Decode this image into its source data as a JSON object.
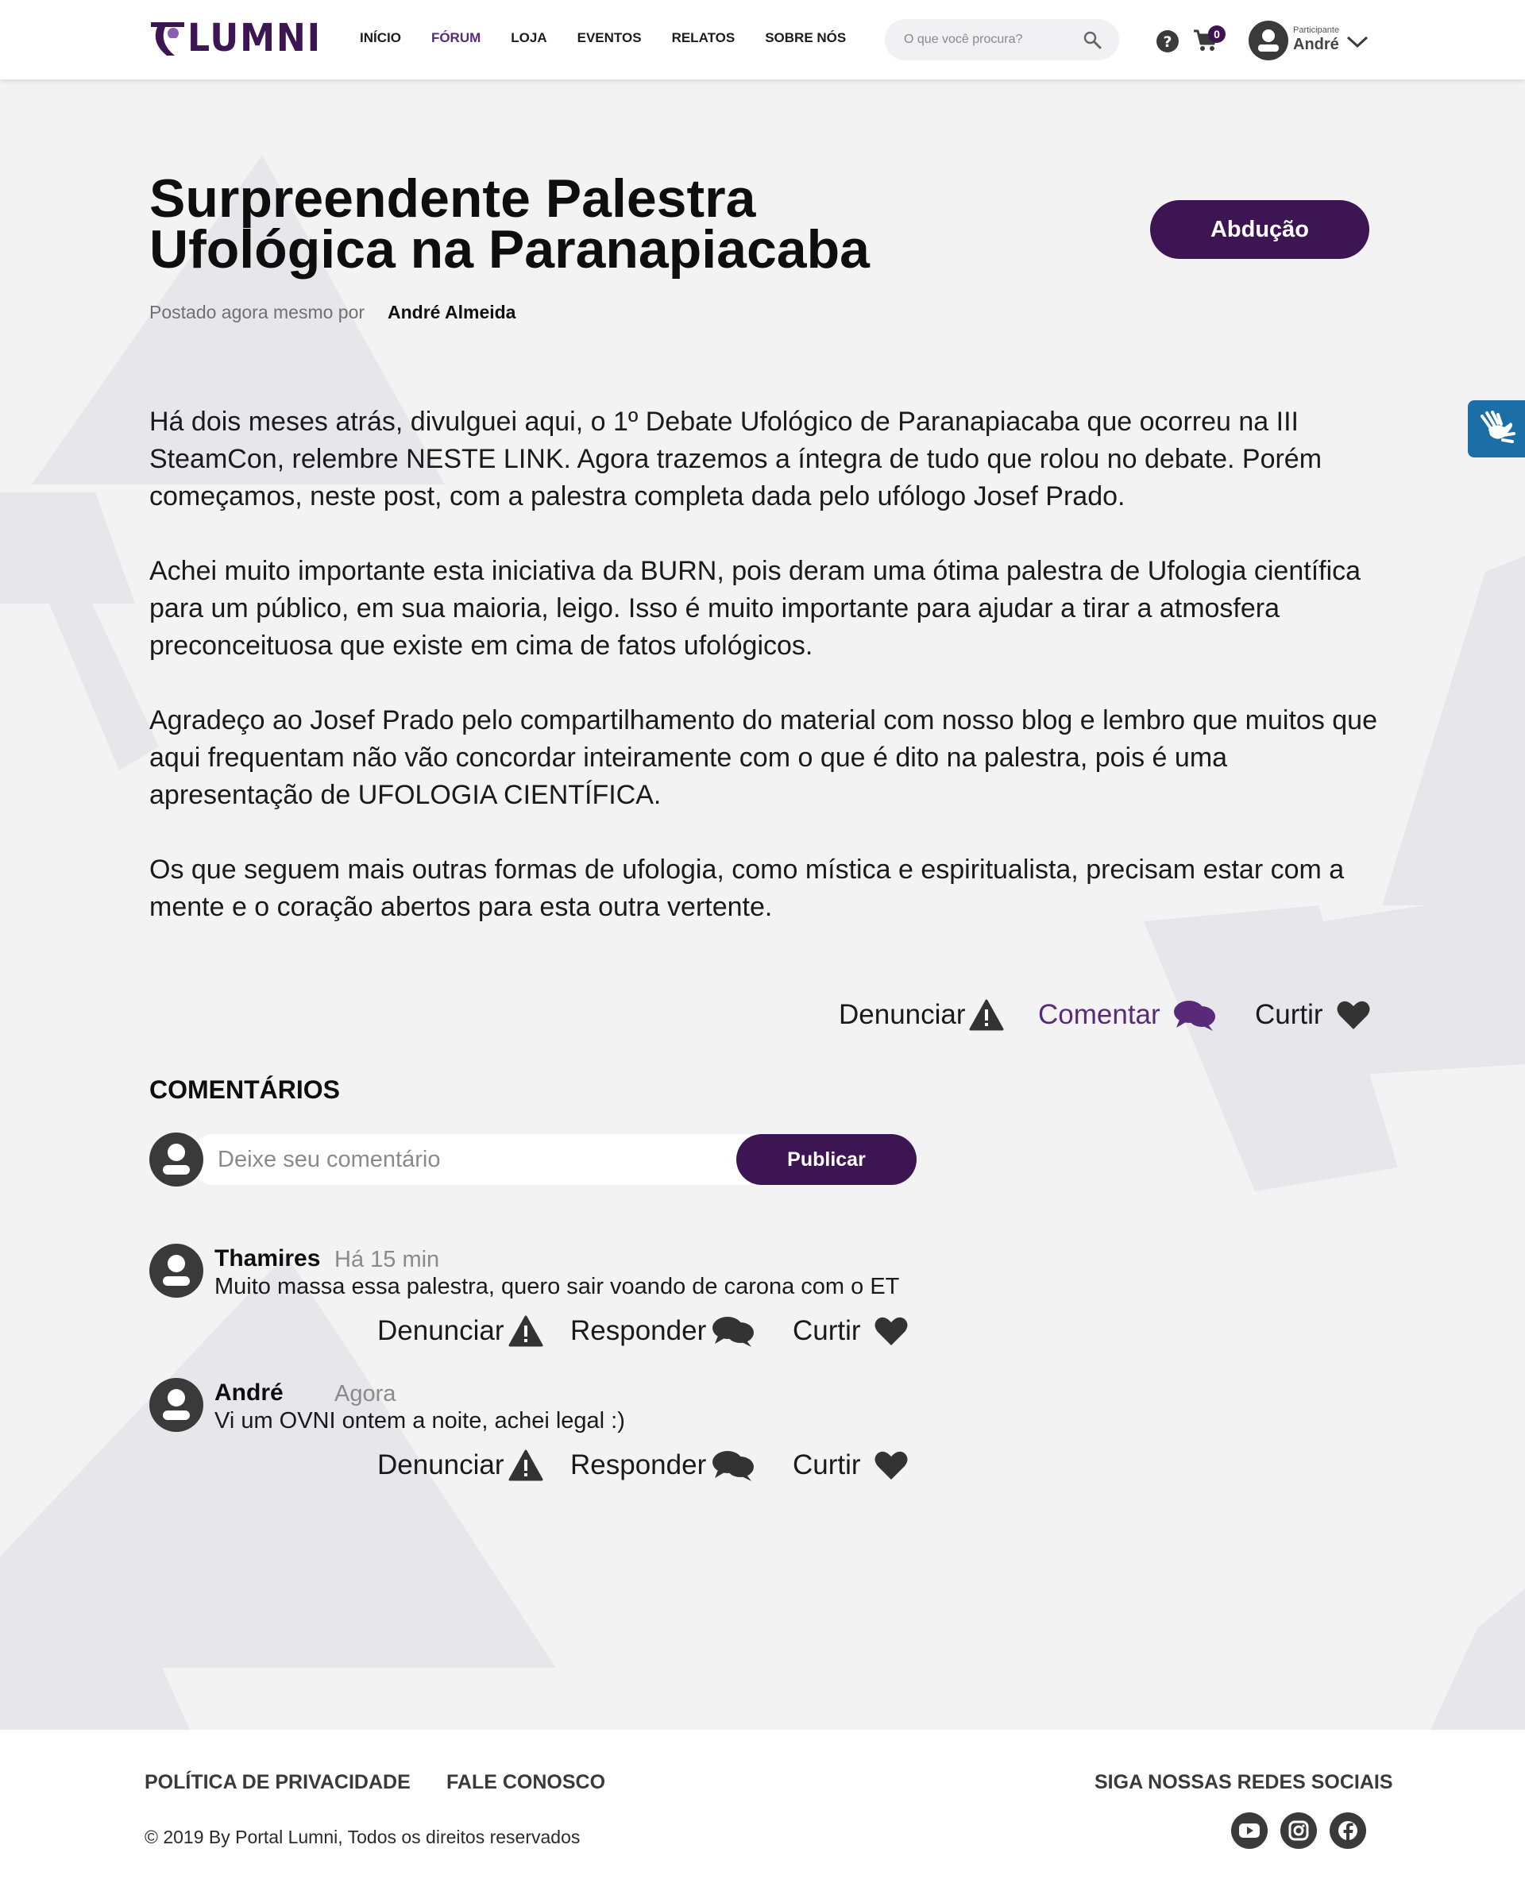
{
  "nav": {
    "logo_text": "LUMNI",
    "items": [
      {
        "label": "INÍCIO",
        "active": false
      },
      {
        "label": "FÓRUM",
        "active": true
      },
      {
        "label": "LOJA",
        "active": false
      },
      {
        "label": "EVENTOS",
        "active": false
      },
      {
        "label": "RELATOS",
        "active": false
      },
      {
        "label": "SOBRE NÓS",
        "active": false
      }
    ],
    "search_placeholder": "O que você procura?",
    "cart_count": "0",
    "user_role": "Participante",
    "user_name": "André"
  },
  "post": {
    "title": "Surpreendente Palestra Ufológica na Paranapiacaba",
    "tag": "Abdução",
    "meta": "Postado agora mesmo por",
    "author": "André Almeida",
    "paragraphs": [
      "Há dois meses atrás, divulguei aqui, o 1º Debate Ufológico de Paranapiacaba que ocorreu na III SteamCon, relembre NESTE LINK. Agora trazemos a íntegra de tudo que rolou no debate. Porém começamos, neste post, com a palestra completa dada pelo ufólogo Josef Prado.",
      "Achei muito importante esta iniciativa da BURN, pois deram uma ótima palestra de Ufologia científica para um público, em sua maioria, leigo. Isso é muito importante para ajudar a tirar a atmosfera preconceituosa que existe em cima de fatos ufológicos.",
      "Agradeço ao Josef Prado pelo compartilhamento do material com nosso blog e lembro que muitos que aqui frequentam não vão concordar inteiramente com o que é dito na palestra, pois é uma apresentação de UFOLOGIA CIENTÍFICA.",
      "Os que seguem mais outras formas de ufologia, como mística e espiritualista, precisam estar com a mente e o coração abertos para esta outra vertente."
    ],
    "actions": {
      "report": "Denunciar",
      "comment": "Comentar",
      "like": "Curtir"
    }
  },
  "comments": {
    "title": "COMENTÁRIOS",
    "input_placeholder": "Deixe seu comentário",
    "publish_label": "Publicar",
    "items": [
      {
        "author": "Thamires",
        "time": "Há 15 min",
        "text": "Muito massa essa palestra, quero sair voando de carona com o ET"
      },
      {
        "author": "André",
        "time": "Agora",
        "text": "Vi um OVNI ontem a noite, achei legal :)"
      }
    ],
    "actions": {
      "report": "Denunciar",
      "reply": "Responder",
      "like": "Curtir"
    }
  },
  "footer": {
    "privacy": "POLÍTICA DE PRIVACIDADE",
    "contact": "FALE CONOSCO",
    "copyright": "© 2019 By Portal Lumni, Todos os direitos reservados",
    "social_title": "SIGA NOSSAS REDES SOCIAIS",
    "social_icons": [
      "youtube-icon",
      "instagram-icon",
      "facebook-icon"
    ]
  },
  "colors": {
    "brand_purple": "#3d1552",
    "active_purple": "#5a2a7a",
    "background": "#f3f3f4",
    "accessibility_blue": "#1b6fa6"
  }
}
